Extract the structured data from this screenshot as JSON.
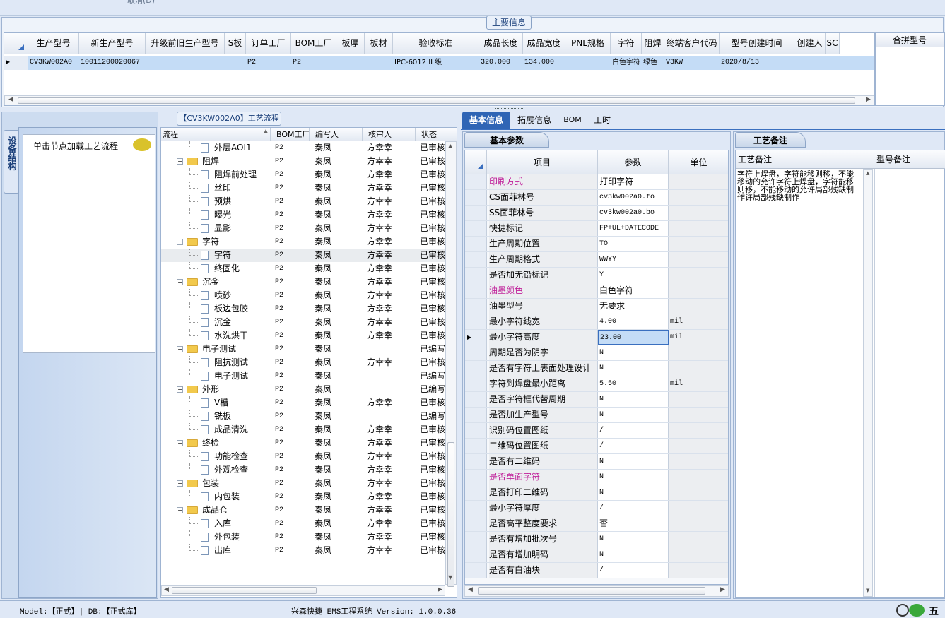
{
  "topbar": {
    "cut_label": "取消(D)"
  },
  "main_info": {
    "title": "主要信息",
    "columns": [
      "生产型号",
      "新生产型号",
      "升级前旧生产型号",
      "S板",
      "订单工厂",
      "BOM工厂",
      "板厚",
      "板材",
      "验收标准",
      "成品长度",
      "成品宽度",
      "PNL规格",
      "字符",
      "阻焊",
      "终端客户代码",
      "型号创建时间",
      "创建人",
      "SC"
    ],
    "row": [
      "CV3KW002A0",
      "10011200020067",
      "",
      "",
      "P2",
      "P2",
      "",
      "",
      "IPC-6012 II 级",
      "320.000",
      "134.000",
      "",
      "白色字符",
      "绿色",
      "V3KW",
      "2020/8/13",
      "",
      ""
    ],
    "merge_header": "合拼型号"
  },
  "left_panel": {
    "vertical_tab": "设备结构",
    "hint": "单击节点加载工艺流程",
    "process_title": "【CV3KW002A0】工艺流程"
  },
  "tree": {
    "columns": [
      "流程",
      "BOM工厂",
      "编写人",
      "核审人",
      "状态"
    ],
    "rows": [
      {
        "t": "doc",
        "label": "外层AOI1",
        "bom": "P2",
        "writer": "秦凤",
        "rev": "方幸幸",
        "st": "已审核"
      },
      {
        "t": "folder",
        "label": "阻焊",
        "bom": "P2",
        "writer": "秦凤",
        "rev": "方幸幸",
        "st": "已审核"
      },
      {
        "t": "doc",
        "label": "阻焊前处理",
        "bom": "P2",
        "writer": "秦凤",
        "rev": "方幸幸",
        "st": "已审核"
      },
      {
        "t": "doc",
        "label": "丝印",
        "bom": "P2",
        "writer": "秦凤",
        "rev": "方幸幸",
        "st": "已审核"
      },
      {
        "t": "doc",
        "label": "预烘",
        "bom": "P2",
        "writer": "秦凤",
        "rev": "方幸幸",
        "st": "已审核"
      },
      {
        "t": "doc",
        "label": "曝光",
        "bom": "P2",
        "writer": "秦凤",
        "rev": "方幸幸",
        "st": "已审核"
      },
      {
        "t": "doc",
        "label": "显影",
        "bom": "P2",
        "writer": "秦凤",
        "rev": "方幸幸",
        "st": "已审核"
      },
      {
        "t": "folder",
        "label": "字符",
        "bom": "P2",
        "writer": "秦凤",
        "rev": "方幸幸",
        "st": "已审核"
      },
      {
        "t": "doc",
        "label": "字符",
        "bom": "P2",
        "writer": "秦凤",
        "rev": "方幸幸",
        "st": "已审核",
        "sel": true
      },
      {
        "t": "doc",
        "label": "终固化",
        "bom": "P2",
        "writer": "秦凤",
        "rev": "方幸幸",
        "st": "已审核"
      },
      {
        "t": "folder",
        "label": "沉金",
        "bom": "P2",
        "writer": "秦凤",
        "rev": "方幸幸",
        "st": "已审核"
      },
      {
        "t": "doc",
        "label": "喷砂",
        "bom": "P2",
        "writer": "秦凤",
        "rev": "方幸幸",
        "st": "已审核"
      },
      {
        "t": "doc",
        "label": "板边包胶",
        "bom": "P2",
        "writer": "秦凤",
        "rev": "方幸幸",
        "st": "已审核"
      },
      {
        "t": "doc",
        "label": "沉金",
        "bom": "P2",
        "writer": "秦凤",
        "rev": "方幸幸",
        "st": "已审核"
      },
      {
        "t": "doc",
        "label": "水洗烘干",
        "bom": "P2",
        "writer": "秦凤",
        "rev": "方幸幸",
        "st": "已审核"
      },
      {
        "t": "folder",
        "label": "电子测试",
        "bom": "P2",
        "writer": "秦凤",
        "rev": "",
        "st": "已编写"
      },
      {
        "t": "doc",
        "label": "阻抗测试",
        "bom": "P2",
        "writer": "秦凤",
        "rev": "方幸幸",
        "st": "已审核"
      },
      {
        "t": "doc",
        "label": "电子测试",
        "bom": "P2",
        "writer": "秦凤",
        "rev": "",
        "st": "已编写"
      },
      {
        "t": "folder",
        "label": "外形",
        "bom": "P2",
        "writer": "秦凤",
        "rev": "",
        "st": "已编写"
      },
      {
        "t": "doc",
        "label": "V槽",
        "bom": "P2",
        "writer": "秦凤",
        "rev": "方幸幸",
        "st": "已审核"
      },
      {
        "t": "doc",
        "label": "铣板",
        "bom": "P2",
        "writer": "秦凤",
        "rev": "",
        "st": "已编写"
      },
      {
        "t": "doc",
        "label": "成品清洗",
        "bom": "P2",
        "writer": "秦凤",
        "rev": "方幸幸",
        "st": "已审核"
      },
      {
        "t": "folder",
        "label": "终检",
        "bom": "P2",
        "writer": "秦凤",
        "rev": "方幸幸",
        "st": "已审核"
      },
      {
        "t": "doc",
        "label": "功能检查",
        "bom": "P2",
        "writer": "秦凤",
        "rev": "方幸幸",
        "st": "已审核"
      },
      {
        "t": "doc",
        "label": "外观检查",
        "bom": "P2",
        "writer": "秦凤",
        "rev": "方幸幸",
        "st": "已审核"
      },
      {
        "t": "folder",
        "label": "包装",
        "bom": "P2",
        "writer": "秦凤",
        "rev": "方幸幸",
        "st": "已审核"
      },
      {
        "t": "doc",
        "label": "内包装",
        "bom": "P2",
        "writer": "秦凤",
        "rev": "方幸幸",
        "st": "已审核"
      },
      {
        "t": "folder",
        "label": "成品仓",
        "bom": "P2",
        "writer": "秦凤",
        "rev": "方幸幸",
        "st": "已审核"
      },
      {
        "t": "doc",
        "label": "入库",
        "bom": "P2",
        "writer": "秦凤",
        "rev": "方幸幸",
        "st": "已审核"
      },
      {
        "t": "doc",
        "label": "外包装",
        "bom": "P2",
        "writer": "秦凤",
        "rev": "方幸幸",
        "st": "已审核"
      },
      {
        "t": "doc",
        "label": "出库",
        "bom": "P2",
        "writer": "秦凤",
        "rev": "方幸幸",
        "st": "已审核"
      }
    ]
  },
  "tabs": [
    "基本信息",
    "拓展信息",
    "BOM",
    "工时"
  ],
  "params": {
    "title": "基本参数",
    "columns": [
      "项目",
      "参数",
      "单位"
    ],
    "rows": [
      {
        "k": "印刷方式",
        "v": "打印字符",
        "u": "",
        "pink": true
      },
      {
        "k": "CS面菲林号",
        "v": "cv3kw002a0.to",
        "u": ""
      },
      {
        "k": "SS面菲林号",
        "v": "cv3kw002a0.bo",
        "u": ""
      },
      {
        "k": "快捷标记",
        "v": "FP+UL+DATECODE",
        "u": ""
      },
      {
        "k": "生产周期位置",
        "v": "TO",
        "u": ""
      },
      {
        "k": "生产周期格式",
        "v": "WWYY",
        "u": ""
      },
      {
        "k": "是否加无铅标记",
        "v": "Y",
        "u": ""
      },
      {
        "k": "油墨颜色",
        "v": "白色字符",
        "u": "",
        "pink": true
      },
      {
        "k": "油墨型号",
        "v": "无要求",
        "u": ""
      },
      {
        "k": "最小字符线宽",
        "v": "4.00",
        "u": "mil"
      },
      {
        "k": "最小字符高度",
        "v": "23.00",
        "u": "mil",
        "sel": true
      },
      {
        "k": "周期是否为阴字",
        "v": "N",
        "u": ""
      },
      {
        "k": "是否有字符上表面处理设计",
        "v": "N",
        "u": ""
      },
      {
        "k": "字符到焊盘最小距离",
        "v": "5.50",
        "u": "mil"
      },
      {
        "k": "是否字符框代替周期",
        "v": "N",
        "u": ""
      },
      {
        "k": "是否加生产型号",
        "v": "N",
        "u": ""
      },
      {
        "k": "识别码位置图纸",
        "v": "/",
        "u": ""
      },
      {
        "k": "二维码位置图纸",
        "v": "/",
        "u": ""
      },
      {
        "k": "是否有二维码",
        "v": "N",
        "u": ""
      },
      {
        "k": "是否单面字符",
        "v": "N",
        "u": "",
        "pink": true
      },
      {
        "k": "是否打印二维码",
        "v": "N",
        "u": ""
      },
      {
        "k": "最小字符厚度",
        "v": "/",
        "u": ""
      },
      {
        "k": "是否高平整度要求",
        "v": "否",
        "u": ""
      },
      {
        "k": "是否有增加批次号",
        "v": "N",
        "u": ""
      },
      {
        "k": "是否有增加明码",
        "v": "N",
        "u": ""
      },
      {
        "k": "是否有白油块",
        "v": "/",
        "u": ""
      }
    ]
  },
  "remarks": {
    "title": "工艺备注",
    "col1": "工艺备注",
    "col2": "型号备注",
    "text": "字符上焊盘，字符能移则移，不能移动的允许字符上焊盘，字符能移则移，不能移动的允许局部残缺制作许局部残缺制作"
  },
  "status": {
    "model": "Model:【正式】||DB:【正式库】",
    "app": "兴森快捷 EMS工程系统 Version: 1.0.0.36",
    "corner": "五"
  }
}
